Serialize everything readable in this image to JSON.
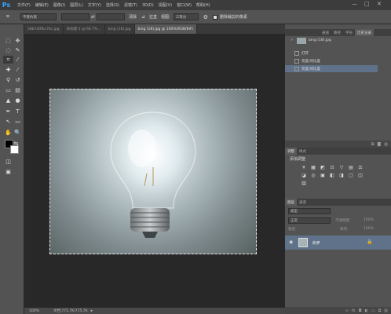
{
  "app": {
    "logo": "Ps"
  },
  "menu": [
    "文件(F)",
    "编辑(E)",
    "图像(I)",
    "图层(L)",
    "文字(Y)",
    "选择(S)",
    "滤镜(T)",
    "3D(D)",
    "视图(V)",
    "窗口(W)",
    "帮助(H)"
  ],
  "window_controls": [
    "—",
    "□",
    "✕"
  ],
  "options": {
    "ratio": "不受约束",
    "clear": "清除",
    "straighten_label": "拉直",
    "view_label": "视图:",
    "view_value": "三等分",
    "delete_crop_label": "删除裁剪的像素"
  },
  "tabs": [
    "58b7d0fbc7bc.jpg",
    "未标题-1 @ 66.7%...",
    "bing (18).jpg",
    "bing (18).jpg @ 100%(RGB/8#)"
  ],
  "status": {
    "zoom": "100%",
    "doc": "文档:775.7K/775.7K"
  },
  "history_panel": {
    "tabs": [
      "通道",
      "路径",
      "字符",
      "历史记录"
    ],
    "snapshot": "bing (18).jpg",
    "items": [
      "打开",
      "亮度/对比度",
      "亮度/对比度"
    ]
  },
  "adjust_panel": {
    "tabs": [
      "调整",
      "样式"
    ],
    "title": "添加调整",
    "icons": [
      "☀",
      "▦",
      "◩",
      "⊡",
      "▽",
      "▤",
      "⚖",
      "◪",
      "◎",
      "▣",
      "◧",
      "◨",
      "▢",
      "◫",
      "▥"
    ]
  },
  "layers_panel": {
    "tabs": [
      "图层",
      "通道"
    ],
    "filter_label": "类型",
    "blend_mode": "正常",
    "opacity_label": "不透明度:",
    "opacity_value": "100%",
    "lock_label": "锁定:",
    "fill_label": "填充:",
    "fill_value": "100%",
    "layer_name": "背景"
  }
}
